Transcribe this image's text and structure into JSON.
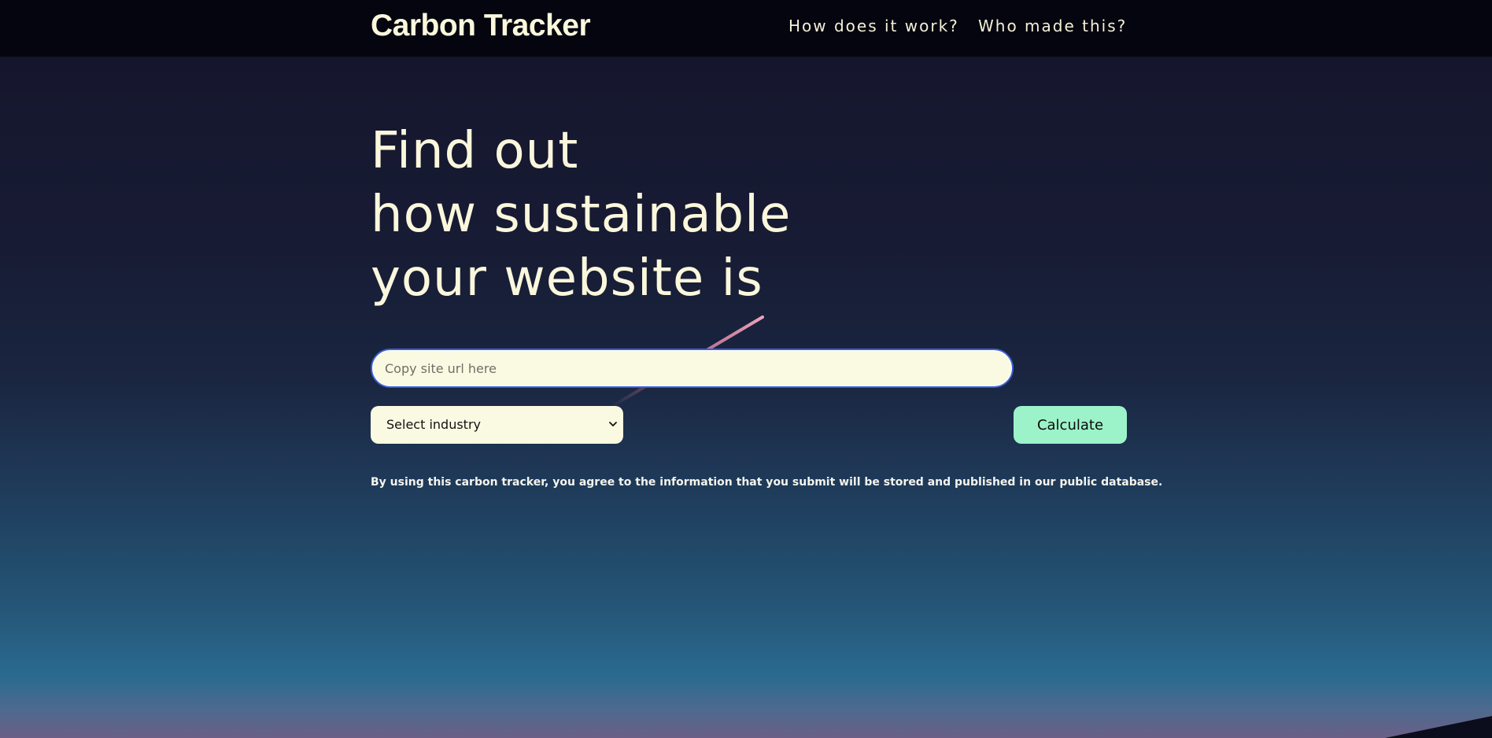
{
  "header": {
    "brand": "Carbon Tracker",
    "nav": {
      "how_it_works": "How does it work?",
      "who_made_this": "Who made this?"
    }
  },
  "hero": {
    "lines": [
      "Find out",
      "how sustainable",
      "your website is"
    ]
  },
  "form": {
    "url_placeholder": "Copy site url here",
    "url_value": "",
    "industry_select": {
      "selected": "Select industry",
      "icon": "chevron-down-icon"
    },
    "calculate_label": "Calculate"
  },
  "disclaimer": "By using this carbon tracker, you agree to the information that you submit will be stored and published in our public database.",
  "colors": {
    "header_bg": "#05050f",
    "text_cream": "#fbf7dc",
    "input_bg": "#fafae3",
    "button_mint": "#9cf3c9",
    "input_focus_border": "#3a5fd0",
    "streak_pink": "#e58aa8"
  }
}
